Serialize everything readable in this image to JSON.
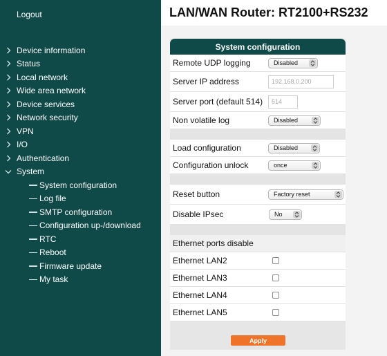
{
  "header": {
    "title": "LAN/WAN Router: RT2100+RS232"
  },
  "sidebar": {
    "logout_label": "Logout",
    "items": [
      {
        "label": "Device information",
        "expanded": false
      },
      {
        "label": "Status",
        "expanded": false
      },
      {
        "label": "Local network",
        "expanded": false
      },
      {
        "label": "Wide area network",
        "expanded": false
      },
      {
        "label": "Device services",
        "expanded": false
      },
      {
        "label": "Network security",
        "expanded": false
      },
      {
        "label": "VPN",
        "expanded": false
      },
      {
        "label": "I/O",
        "expanded": false
      },
      {
        "label": "Authentication",
        "expanded": false
      },
      {
        "label": "System",
        "expanded": true
      }
    ],
    "system_subitems": [
      "System configuration",
      "Log file",
      "SMTP configuration",
      "Configuration up-/download",
      "RTC",
      "Reboot",
      "Firmware update",
      "My task"
    ]
  },
  "panel": {
    "title": "System configuration",
    "remote_udp_logging": {
      "label": "Remote UDP logging",
      "value": "Disabled"
    },
    "server_ip": {
      "label": "Server IP address",
      "placeholder": "192.168.0.200"
    },
    "server_port": {
      "label": "Server port (default 514)",
      "placeholder": "514"
    },
    "non_volatile_log": {
      "label": "Non volatile log",
      "value": "Disabled"
    },
    "load_configuration": {
      "label": "Load configuration",
      "value": "Disabled"
    },
    "configuration_unlock": {
      "label": "Configuration unlock",
      "value": "once"
    },
    "reset_button": {
      "label": "Reset button",
      "value": "Factory reset"
    },
    "disable_ipsec": {
      "label": "Disable IPsec",
      "value": "No"
    },
    "ethernet_ports_disable": {
      "label": "Ethernet ports disable"
    },
    "eth_lan2": {
      "label": "Ethernet LAN2",
      "checked": false
    },
    "eth_lan3": {
      "label": "Ethernet LAN3",
      "checked": false
    },
    "eth_lan4": {
      "label": "Ethernet LAN4",
      "checked": false
    },
    "eth_lan5": {
      "label": "Ethernet LAN5",
      "checked": false
    },
    "apply_label": "Apply"
  },
  "colors": {
    "sidebar": "#0f4a49",
    "apply": "#ef742a",
    "panel_header": "#0f4a49"
  }
}
